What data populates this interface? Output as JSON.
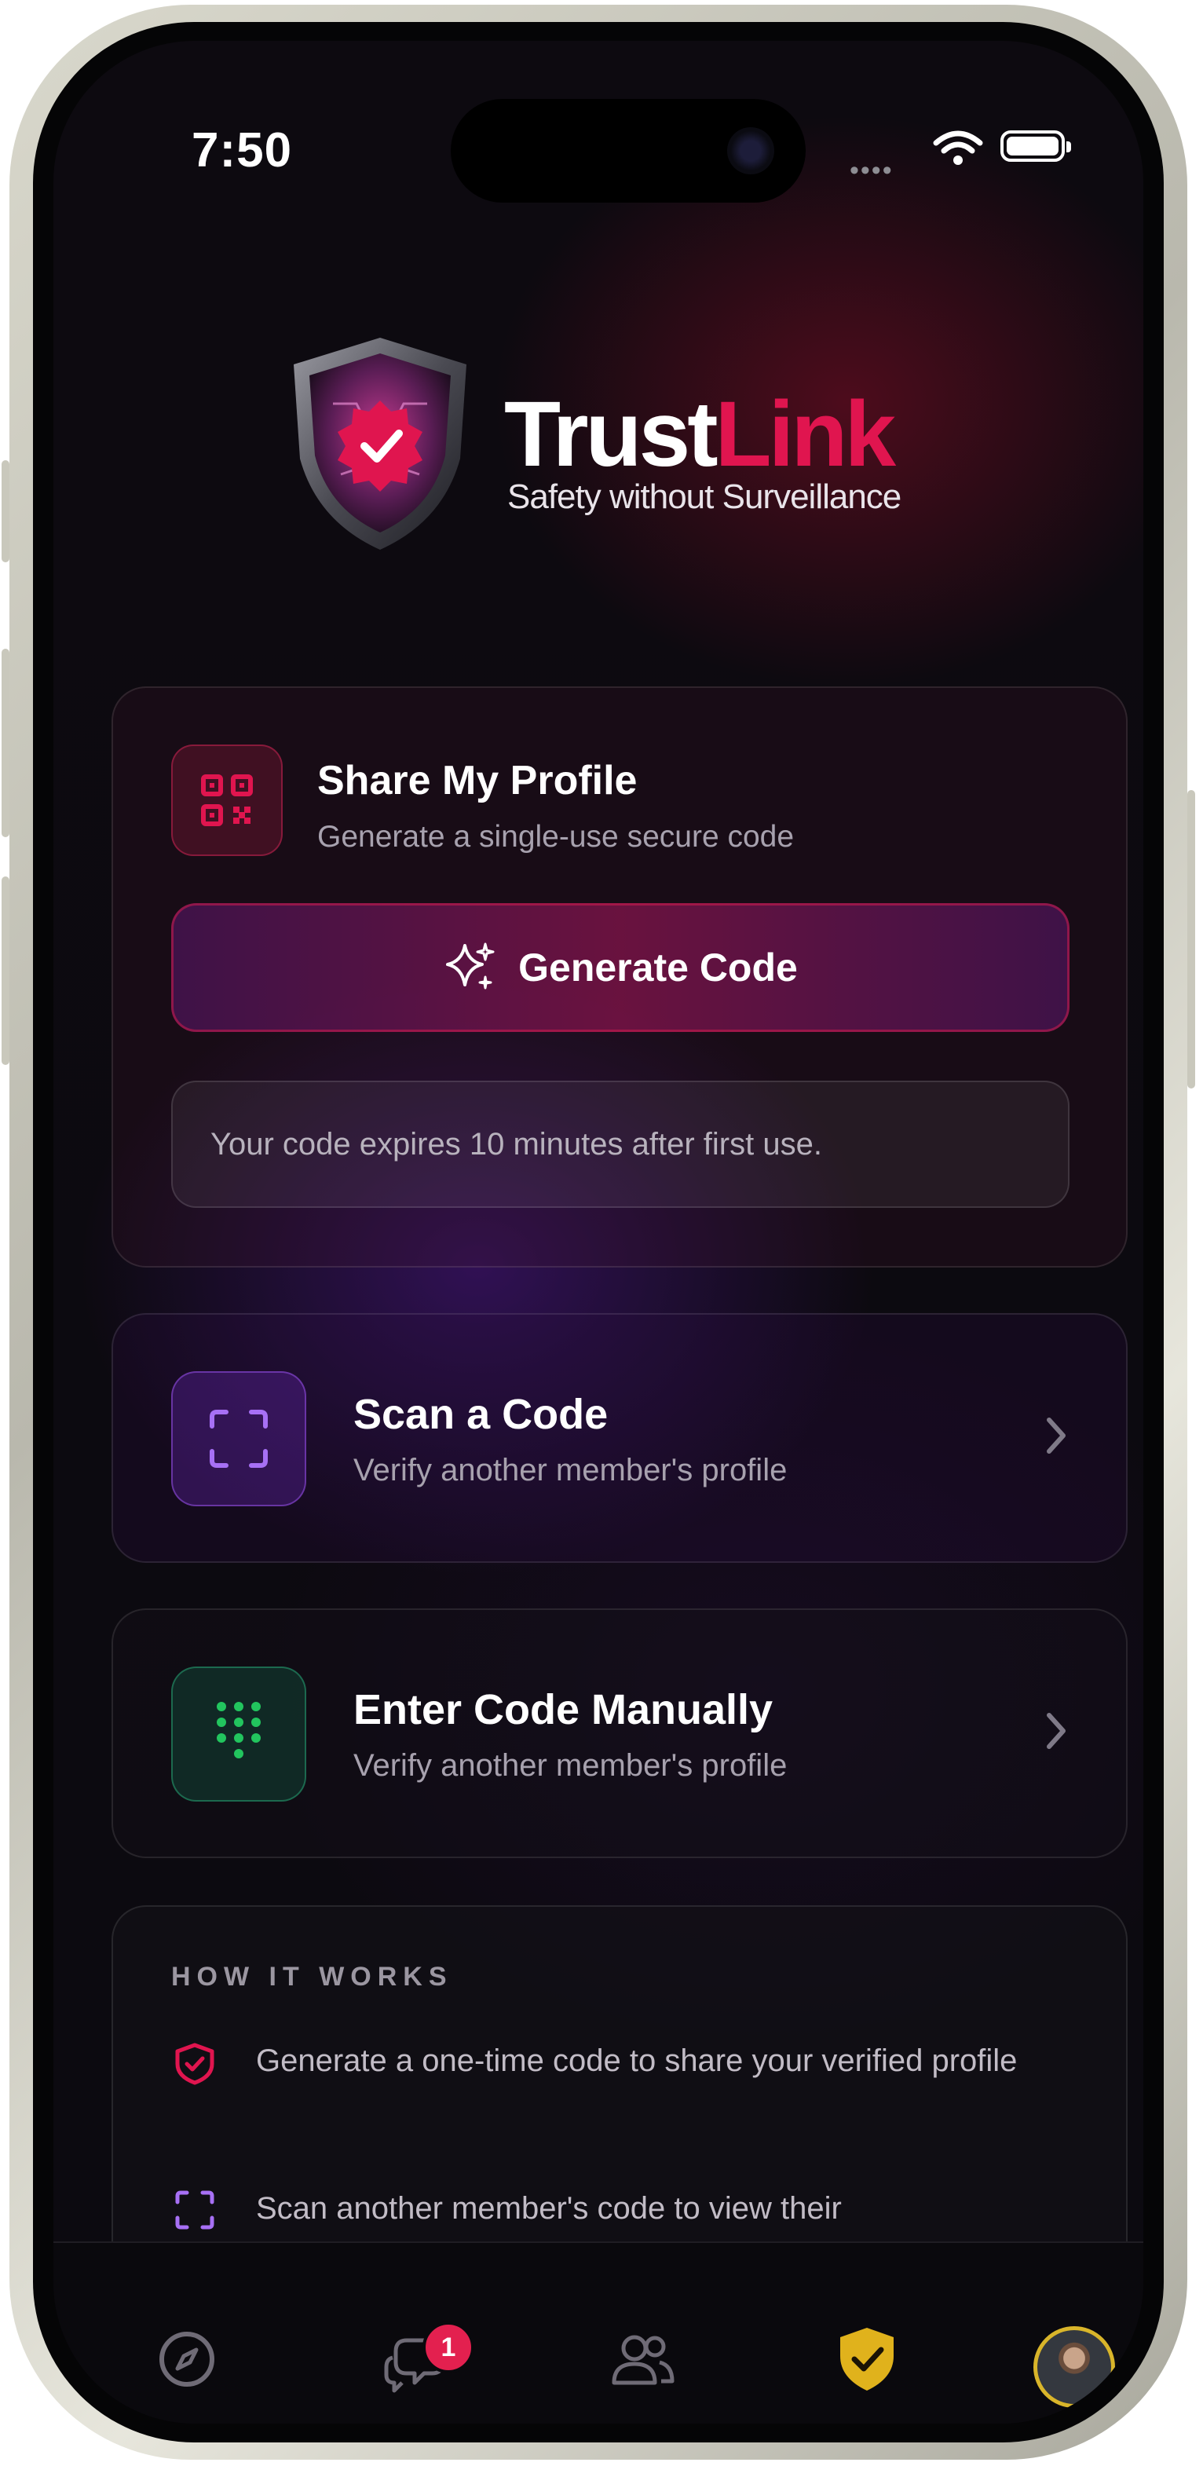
{
  "status_bar": {
    "time": "7:50",
    "signal": "••••"
  },
  "brand": {
    "name_part1": "Trust",
    "name_part2": "Link",
    "tagline": "Safety without Surveillance"
  },
  "share": {
    "title": "Share My Profile",
    "subtitle": "Generate a single-use secure code",
    "button_label": "Generate Code",
    "note": "Your code expires 10 minutes after first use."
  },
  "scan": {
    "title": "Scan a Code",
    "subtitle": "Verify another member's profile"
  },
  "enter": {
    "title": "Enter Code Manually",
    "subtitle": "Verify another member's profile"
  },
  "how": {
    "title": "HOW IT WORKS",
    "items": [
      {
        "icon": "shield-check-icon",
        "text": "Generate a one-time code to share your verified profile"
      },
      {
        "icon": "scan-frame-icon",
        "text": "Scan another member's code to view their"
      }
    ]
  },
  "tabbar": {
    "items": [
      {
        "icon": "compass-icon"
      },
      {
        "icon": "chat-icon",
        "badge": "1"
      },
      {
        "icon": "people-icon"
      },
      {
        "icon": "shield-check-icon",
        "active": true
      },
      {
        "icon": "avatar"
      }
    ]
  },
  "colors": {
    "accent_red": "#e0154f",
    "accent_purple": "#8b5cf6",
    "accent_green": "#22c55e",
    "active_tab": "#e0b21c"
  }
}
